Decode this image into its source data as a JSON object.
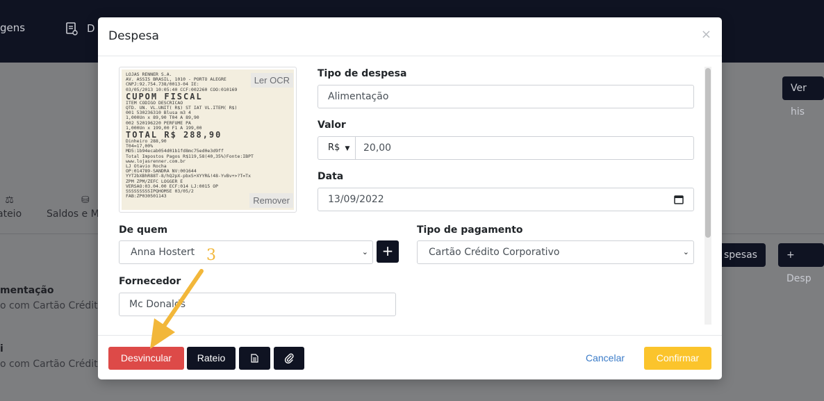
{
  "background": {
    "nav": {
      "viagens_partial": "gens",
      "despesas_partial": "D"
    },
    "ver_historico_partial": "Ver his",
    "tabs": {
      "rateio_partial": "ateio",
      "saldos_partial": "Saldos e M"
    },
    "despesas_button_partial": "spesas",
    "add_despesa_button_partial": "+ Desp",
    "rows": [
      {
        "title": "mentação",
        "subtitle": "o com Cartão Crédit"
      },
      {
        "title": "i",
        "subtitle": "o com Cartão Crédit"
      }
    ]
  },
  "modal": {
    "title": "Despesa",
    "close": "×",
    "receipt": {
      "ocr_label": "Ler OCR",
      "remove_label": "Remover",
      "lines": [
        "LOJAS RENNER S.A.",
        "AV. ASSIS BRASIL, 1010 - PORTO ALEGRE",
        "CNPJ:92.754.738/0013-04        IE:",
        "03/05/2013 10:05:40  CCF:002260  COO:010169",
        "CUPOM FISCAL",
        "ITEM CODIGO        DESCRICAO",
        "QTD.   UN.   VL.UNIT( R$) ST IAT  VL.ITEM( R$)",
        "001 530236310      Blusa m3 4",
        "    1,000Un x      89,90 T04  A          89,90",
        "002 520196220      PERFUME PA",
        "    1,000Un x     199,00 F1   A         199,00",
        "TOTAL          R$             288,90",
        "Dinheiro                              288,90",
        "T04=17,00%",
        "MD5:1b94ecab054d01b1fd8mc75ed0e3d9ff",
        "Total Impostos Pagos R$119,58(40,35%)Fonte:IBPT",
        "www.lojasrenner.com.br",
        "LJ Otavio Rocha",
        "OP:014789-SANDRA NV:001644",
        "YYT2bXBhR88T-8/hQ2pX-pbxS+XYYR&!48-YvBv+>?T=Tx",
        "ZPM        ZPM/ZEFC LOGGER      E",
        "VERSAO:03.04.00 ECF:014 LJ:0015 OP",
        "SSSSSSSSSIPQHOMSE           03/05/2",
        "FAB:ZP030501143"
      ]
    },
    "tipo_despesa": {
      "label": "Tipo de despesa",
      "value": "Alimentação"
    },
    "valor": {
      "label": "Valor",
      "currency": "R$",
      "value": "20,00"
    },
    "data": {
      "label": "Data",
      "value": "13/09/2022"
    },
    "de_quem": {
      "label": "De quem",
      "value": "Anna Hostert"
    },
    "tipo_pagamento": {
      "label": "Tipo de pagamento",
      "value": "Cartão Crédito Corporativo"
    },
    "fornecedor": {
      "label": "Fornecedor",
      "value": "Mc Donalds"
    },
    "footer": {
      "desvincular": "Desvincular",
      "rateio": "Rateio",
      "cancelar": "Cancelar",
      "confirmar": "Confirmar"
    }
  },
  "annotation": {
    "step_number": "3",
    "color": "#f2b73a"
  },
  "colors": {
    "dark": "#0f1322",
    "danger": "#dd4a48",
    "warning": "#fbc42c",
    "link": "#3a7bc8"
  }
}
